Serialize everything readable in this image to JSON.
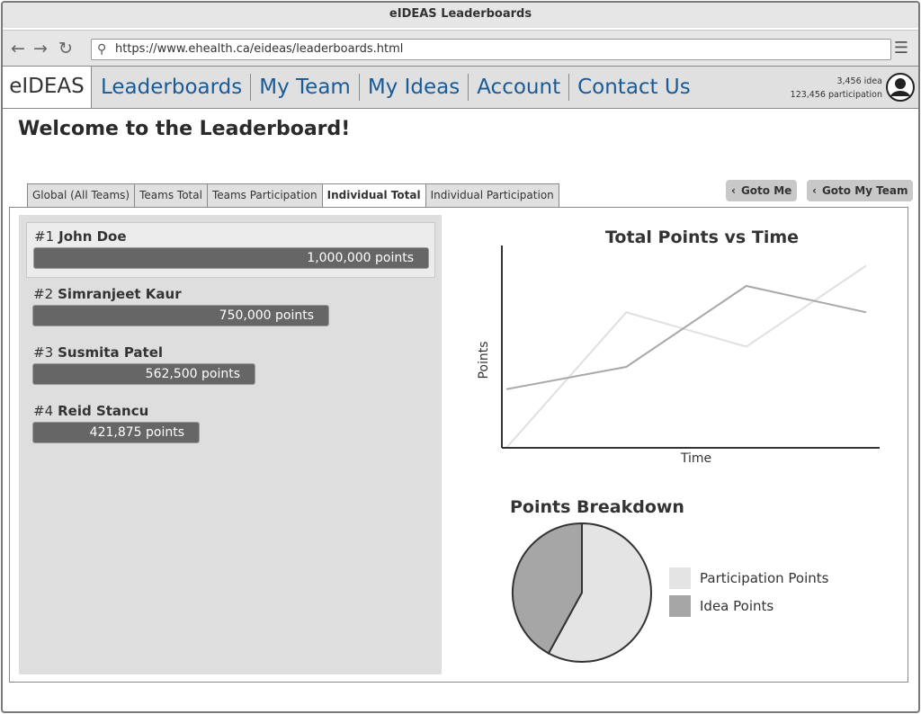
{
  "window": {
    "title": "eIDEAS Leaderboards"
  },
  "browser": {
    "url": "https://www.ehealth.ca/eideas/leaderboards.html",
    "back_icon": "arrow-left",
    "forward_icon": "arrow-right",
    "reload_icon": "reload",
    "menu_icon": "hamburger"
  },
  "nav": {
    "brand": "eIDEAS",
    "links": [
      "Leaderboards",
      "My Team",
      "My Ideas",
      "Account",
      "Contact Us"
    ],
    "stats_ideas": "3,456 idea",
    "stats_participation": "123,456 participation"
  },
  "page": {
    "welcome": "Welcome to the Leaderboard!",
    "tabs": [
      "Global (All Teams)",
      "Teams Total",
      "Teams Participation",
      "Individual Total",
      "Individual Participation"
    ],
    "active_tab": "Individual Total",
    "goto_me": "Goto Me",
    "goto_my_team": "Goto My Team"
  },
  "leaderboard": [
    {
      "rank": "#1",
      "name": "John Doe",
      "points_label": "1,000,000 points",
      "points": 1000000
    },
    {
      "rank": "#2",
      "name": "Simranjeet Kaur",
      "points_label": "750,000 points",
      "points": 750000
    },
    {
      "rank": "#3",
      "name": "Susmita Patel",
      "points_label": "562,500 points",
      "points": 562500
    },
    {
      "rank": "#4",
      "name": "Reid Stancu",
      "points_label": "421,875 points",
      "points": 421875
    }
  ],
  "chart_data": [
    {
      "type": "line",
      "title": "Total Points vs Time",
      "xlabel": "Time",
      "ylabel": "Points",
      "ylim": [
        0,
        100
      ],
      "x": [
        0,
        1,
        2,
        3
      ],
      "series": [
        {
          "values": [
            0,
            67,
            50,
            90
          ],
          "color": "#e0e0e0"
        },
        {
          "values": [
            29,
            40,
            80,
            67
          ],
          "color": "#a8a8a8"
        }
      ]
    },
    {
      "type": "pie",
      "title": "Points Breakdown",
      "labels": [
        "Participation Points",
        "Idea Points"
      ],
      "values": [
        58,
        42
      ],
      "colors": [
        "#e4e4e4",
        "#a6a6a6"
      ]
    }
  ]
}
